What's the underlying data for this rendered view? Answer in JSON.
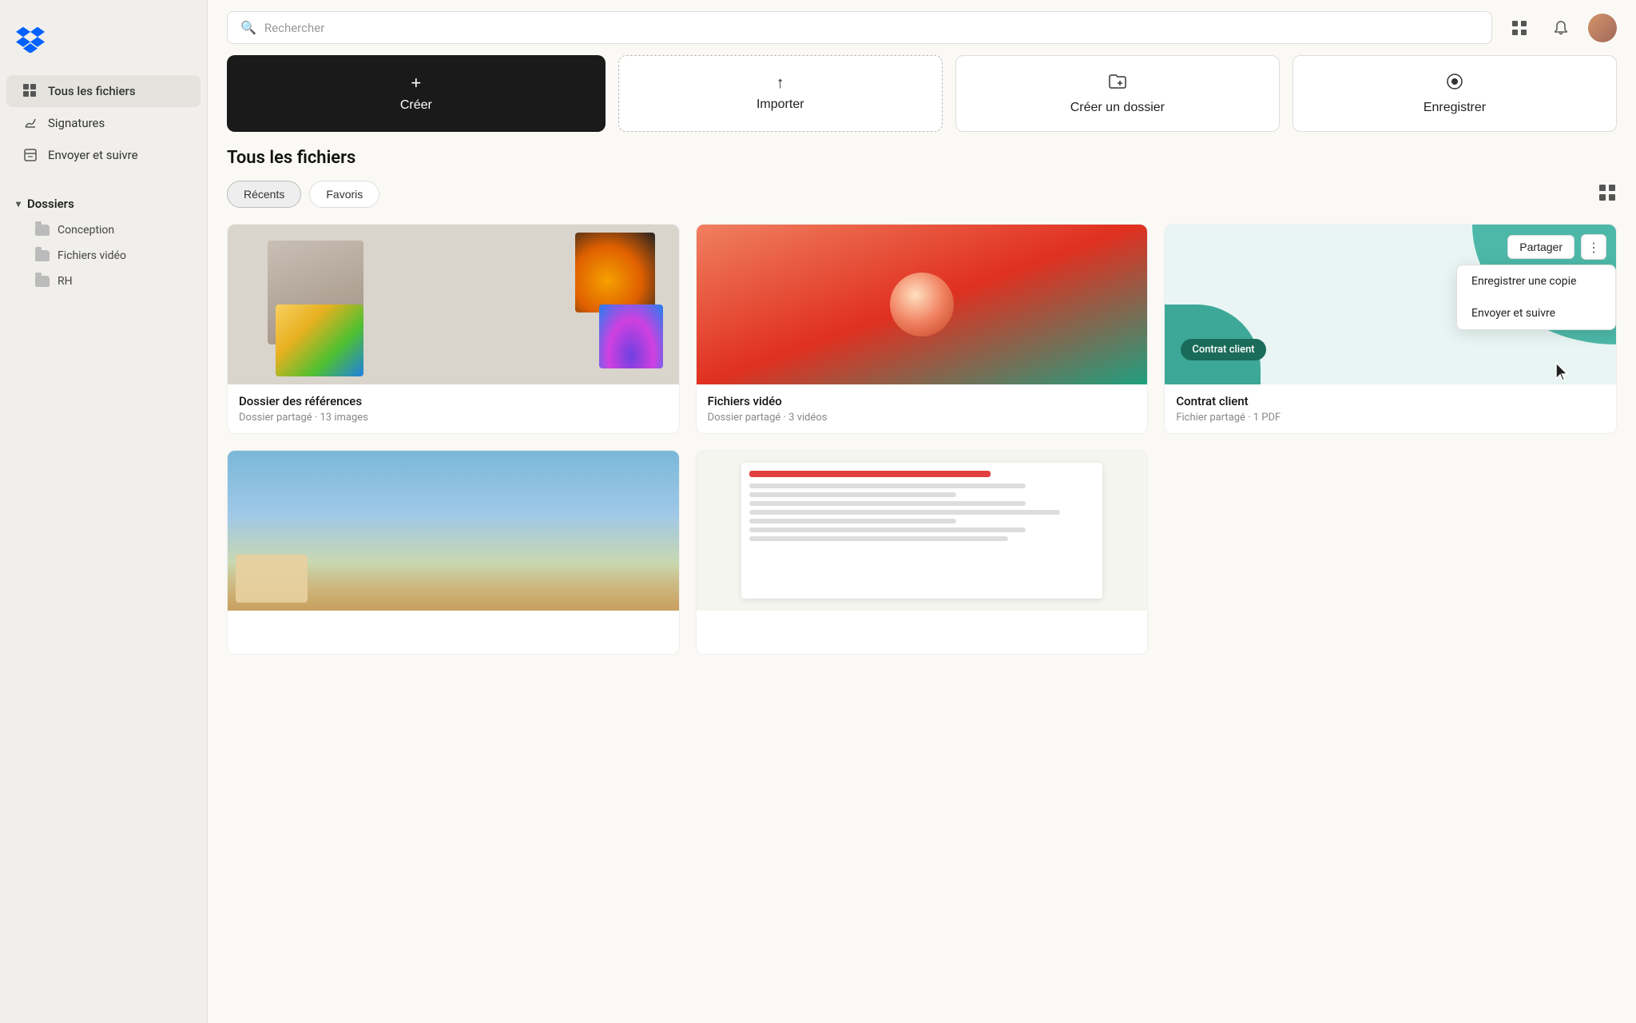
{
  "sidebar": {
    "logo_alt": "Dropbox logo",
    "nav_items": [
      {
        "id": "all-files",
        "label": "Tous les fichiers",
        "active": true
      },
      {
        "id": "signatures",
        "label": "Signatures",
        "active": false
      },
      {
        "id": "send-track",
        "label": "Envoyer et suivre",
        "active": false
      }
    ],
    "folders_section": {
      "title": "Dossiers",
      "items": [
        {
          "id": "conception",
          "label": "Conception"
        },
        {
          "id": "video-files",
          "label": "Fichiers vidéo"
        },
        {
          "id": "rh",
          "label": "RH"
        }
      ]
    }
  },
  "header": {
    "search_placeholder": "Rechercher"
  },
  "action_buttons": [
    {
      "id": "create",
      "label": "Créer",
      "icon": "+"
    },
    {
      "id": "import",
      "label": "Importer",
      "icon": "↑"
    },
    {
      "id": "new-folder",
      "label": "Créer un dossier",
      "icon": "⊡"
    },
    {
      "id": "record",
      "label": "Enregistrer",
      "icon": "⊙"
    }
  ],
  "content": {
    "section_title": "Tous les fichiers",
    "filter_tabs": [
      {
        "id": "recent",
        "label": "Récents",
        "active": true
      },
      {
        "id": "favorites",
        "label": "Favoris",
        "active": false
      }
    ],
    "files": [
      {
        "id": "dossier-references",
        "name": "Dossier des références",
        "meta": "Dossier partagé · 13 images",
        "type": "folder-images"
      },
      {
        "id": "fichiers-video",
        "name": "Fichiers vidéo",
        "meta": "Dossier partagé · 3 vidéos",
        "type": "folder-video"
      },
      {
        "id": "contrat-client",
        "name": "Contrat client",
        "meta": "Fichier partagé · 1 PDF",
        "type": "pdf",
        "has_dropdown": true
      },
      {
        "id": "file-4",
        "name": "",
        "meta": "",
        "type": "partial-landscape"
      },
      {
        "id": "file-5",
        "name": "",
        "meta": "",
        "type": "partial-doc"
      }
    ],
    "dropdown": {
      "share_label": "Partager",
      "more_label": "⋮",
      "items": [
        {
          "id": "save-copy",
          "label": "Enregistrer une copie"
        },
        {
          "id": "send-track",
          "label": "Envoyer et suivre"
        }
      ],
      "contrat_badge": "Contrat client"
    }
  }
}
